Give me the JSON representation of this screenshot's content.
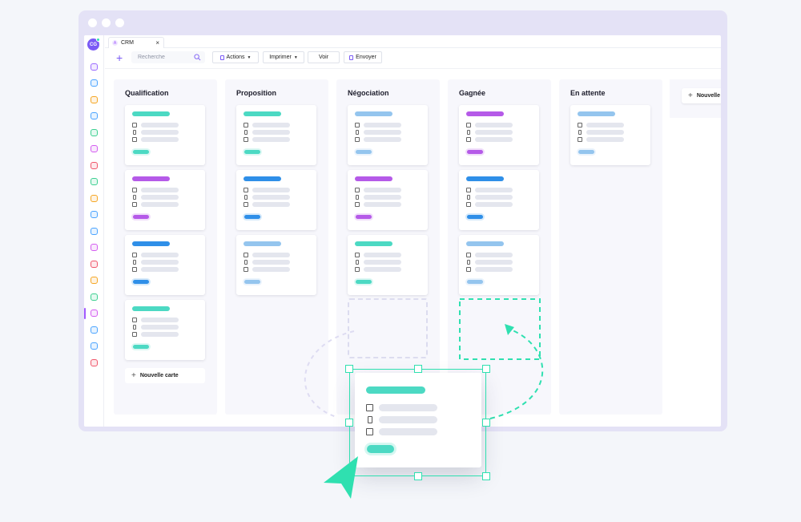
{
  "app": {
    "avatar": "CG",
    "tab": {
      "label": "CRM",
      "icon_letter": "A",
      "close": "×"
    }
  },
  "rail_icons": [
    {
      "icon": "contacts-icon",
      "color": "#9b6bff"
    },
    {
      "icon": "folder-icon",
      "color": "#4aa3ff"
    },
    {
      "icon": "chart-icon",
      "color": "#f5a623"
    },
    {
      "icon": "sync-icon",
      "color": "#4aa3ff"
    },
    {
      "icon": "stats-icon",
      "color": "#3ccf91"
    },
    {
      "icon": "cart-icon",
      "color": "#d45cf0"
    },
    {
      "icon": "block-icon",
      "color": "#f0566a"
    },
    {
      "icon": "briefcase-icon",
      "color": "#3ccf91"
    },
    {
      "icon": "document-icon",
      "color": "#f5a623"
    },
    {
      "icon": "file-icon",
      "color": "#4aa3ff"
    },
    {
      "icon": "monitor-icon",
      "color": "#4aa3ff"
    },
    {
      "icon": "dashboard-icon",
      "color": "#d45cf0"
    },
    {
      "icon": "target-icon",
      "color": "#f0566a"
    },
    {
      "icon": "mail-icon",
      "color": "#f5a623"
    },
    {
      "icon": "chat-icon",
      "color": "#3ccf91"
    },
    {
      "icon": "user-icon",
      "color": "#d45cf0",
      "active": true
    },
    {
      "icon": "page-icon",
      "color": "#4aa3ff"
    },
    {
      "icon": "funnel-icon",
      "color": "#4aa3ff"
    },
    {
      "icon": "archive-icon",
      "color": "#f0566a"
    }
  ],
  "toolbar": {
    "search_placeholder": "Recherche",
    "actions_label": "Actions",
    "print_label": "Imprimer",
    "view_label": "Voir",
    "send_label": "Envoyer"
  },
  "columns": [
    {
      "title": "Qualification",
      "cards": [
        "#4cd9c3",
        "#b55ae8",
        "#2f8fe8",
        "#4cd9c3"
      ],
      "new_card": "Nouvelle carte"
    },
    {
      "title": "Proposition",
      "cards": [
        "#4cd9c3",
        "#2f8fe8",
        "#94c5ee"
      ]
    },
    {
      "title": "Négociation",
      "cards": [
        "#94c5ee",
        "#b55ae8",
        "#4cd9c3"
      ],
      "placeholder": true
    },
    {
      "title": "Gagnée",
      "cards": [
        "#b55ae8",
        "#2f8fe8",
        "#94c5ee"
      ]
    },
    {
      "title": "En attente",
      "cards": [
        "#94c5ee"
      ]
    }
  ],
  "new_column_label": "Nouvelle",
  "colors": {
    "accent": "#2fe0b0",
    "brand": "#7a5af5",
    "dragged_card": "#4cd9c3"
  }
}
